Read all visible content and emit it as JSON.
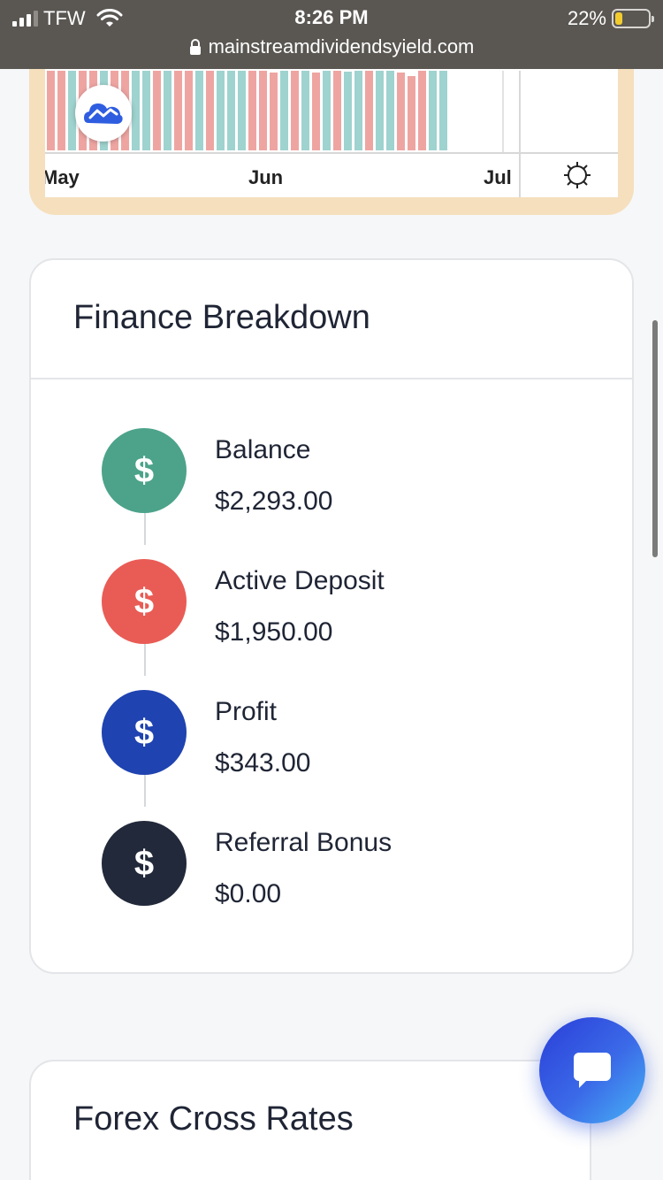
{
  "status_bar": {
    "carrier": "TFW",
    "time": "8:26 PM",
    "battery_percent": "22%",
    "battery_level": 0.22,
    "url": "mainstreamdividendsyield.com"
  },
  "chart": {
    "x_labels": [
      "May",
      "Jun",
      "Jul"
    ],
    "settings_icon": "gear-icon",
    "logo_icon": "tradingview-logo-icon",
    "colors": {
      "up": "#9fd3cf",
      "down": "#eea5a2",
      "frame": "#f5dfbd"
    }
  },
  "finance": {
    "title": "Finance Breakdown",
    "items": [
      {
        "label": "Balance",
        "value": "$2,293.00",
        "icon": "$",
        "color": "#4ca38a"
      },
      {
        "label": "Active Deposit",
        "value": "$1,950.00",
        "icon": "$",
        "color": "#e95c55"
      },
      {
        "label": "Profit",
        "value": "$343.00",
        "icon": "$",
        "color": "#1f43b0"
      },
      {
        "label": "Referral Bonus",
        "value": "$0.00",
        "icon": "$",
        "color": "#22293a"
      }
    ]
  },
  "forex": {
    "title": "Forex Cross Rates"
  },
  "chat": {
    "icon": "chat-bubble-icon"
  }
}
